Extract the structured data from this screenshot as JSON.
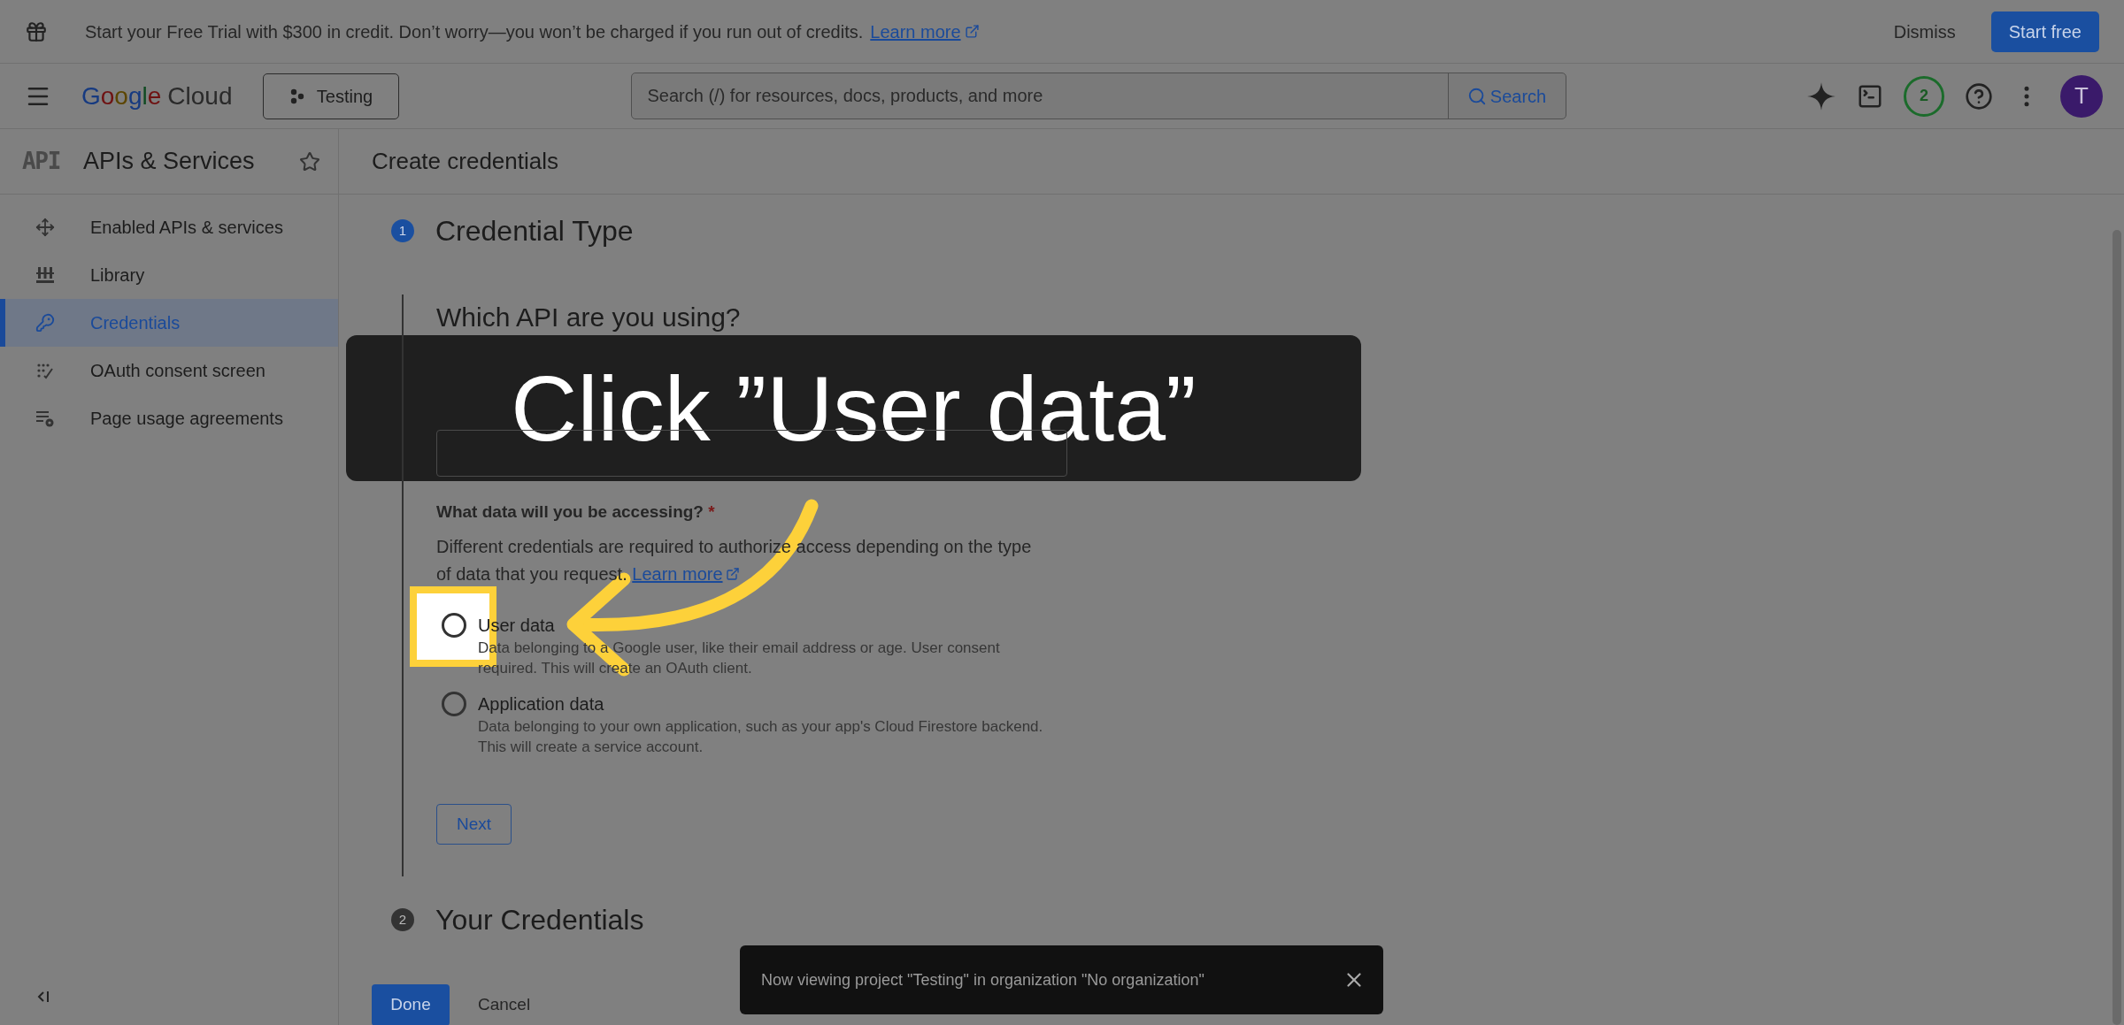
{
  "banner": {
    "message": "Start your Free Trial with $300 in credit. Don’t worry—you won’t be charged if you run out of credits.",
    "link": "Learn more",
    "dismiss": "Dismiss",
    "start": "Start free"
  },
  "header": {
    "logo_google": "Google",
    "logo_cloud": "Cloud",
    "project": "Testing",
    "search_placeholder": "Search (/) for resources, docs, products, and more",
    "search_button": "Search",
    "notifications": "2",
    "avatar": "T"
  },
  "sidebar": {
    "badge": "API",
    "title": "APIs & Services",
    "items": [
      {
        "label": "Enabled APIs & services",
        "selected": false
      },
      {
        "label": "Library",
        "selected": false
      },
      {
        "label": "Credentials",
        "selected": true
      },
      {
        "label": "OAuth consent screen",
        "selected": false
      },
      {
        "label": "Page usage agreements",
        "selected": false
      }
    ]
  },
  "page_title": "Create credentials",
  "steps": [
    {
      "number": "1",
      "title": "Credential Type",
      "active": true
    },
    {
      "number": "2",
      "title": "Your Credentials",
      "active": false
    }
  ],
  "api_section": {
    "heading": "Which API are you using?"
  },
  "data_section": {
    "heading": "What data will you be accessing?",
    "required_mark": "*",
    "description": "Different credentials are required to authorize access depending on the type of data that you request.",
    "link": "Learn more",
    "options": [
      {
        "label": "User data",
        "description": "Data belonging to a Google user, like their email address or age. User consent required. This will create an OAuth client.",
        "selected": false,
        "highlighted": true
      },
      {
        "label": "Application data",
        "description": "Data belonging to your own application, such as your app's Cloud Firestore backend. This will create a service account.",
        "selected": false,
        "highlighted": false
      }
    ]
  },
  "next_button": "Next",
  "done_button": "Done",
  "cancel_button": "Cancel",
  "toast": {
    "message": "Now viewing project \"Testing\" in organization \"No organization\""
  },
  "tutorial": {
    "caption": "Click ”User data”"
  }
}
